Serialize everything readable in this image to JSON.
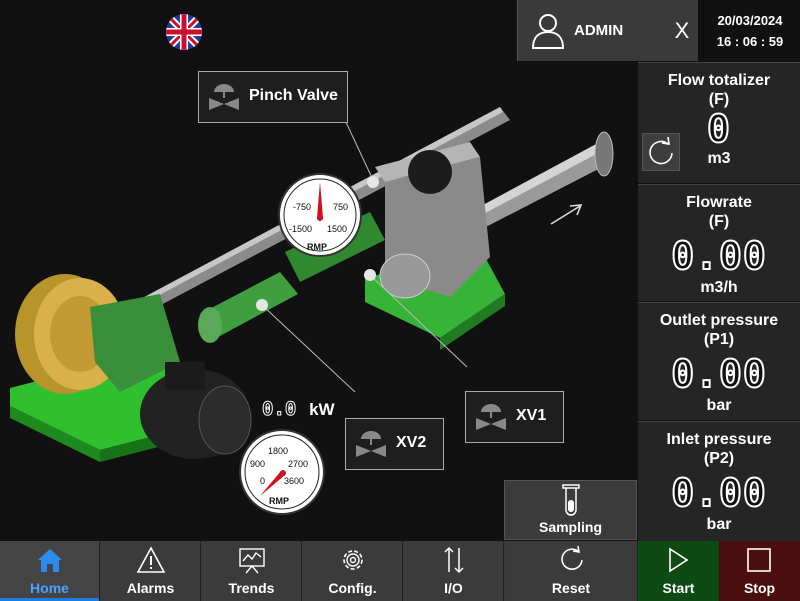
{
  "header": {
    "language_icon": "uk-flag-icon",
    "user": {
      "name": "ADMIN",
      "logout_label": "X"
    },
    "date": "20/03/2024",
    "time": "16 : 06 : 59"
  },
  "valves": {
    "pinch": {
      "label": "Pinch Valve"
    },
    "xv1": {
      "label": "XV1"
    },
    "xv2": {
      "label": "XV2"
    }
  },
  "gauges": {
    "top": {
      "unit": "RMP",
      "ticks": [
        "-750",
        "750",
        "-1500",
        "1500"
      ]
    },
    "bottom": {
      "unit": "RMP",
      "ticks": [
        "1800",
        "900",
        "2700",
        "0",
        "3600"
      ]
    }
  },
  "motor_power": {
    "value": "0.0",
    "unit": "kW"
  },
  "panels": [
    {
      "title": "Flow totalizer",
      "subtitle": "(F)",
      "value": "0",
      "unit": "m3"
    },
    {
      "title": "Flowrate",
      "subtitle": "(F)",
      "value": "0.00",
      "unit": "m3/h"
    },
    {
      "title": "Outlet pressure",
      "subtitle": "(P1)",
      "value": "0.00",
      "unit": "bar"
    },
    {
      "title": "Inlet pressure",
      "subtitle": "(P2)",
      "value": "0.00",
      "unit": "bar"
    }
  ],
  "sampling": {
    "label": "Sampling"
  },
  "nav": [
    {
      "label": "Home",
      "icon": "home-icon",
      "active": true
    },
    {
      "label": "Alarms",
      "icon": "warning-icon"
    },
    {
      "label": "Trends",
      "icon": "trend-icon"
    },
    {
      "label": "Config.",
      "icon": "gear-icon"
    },
    {
      "label": "I/O",
      "icon": "io-arrows-icon"
    },
    {
      "label": "Reset",
      "icon": "reset-icon"
    }
  ],
  "actions": {
    "start": "Start",
    "stop": "Stop"
  },
  "colors": {
    "accent": "#1e7be0",
    "machine_green": "#2fbf2f",
    "start_bg": "#0e4a14",
    "stop_bg": "#4a0e0e",
    "gauge_needle": "#d0101a"
  }
}
